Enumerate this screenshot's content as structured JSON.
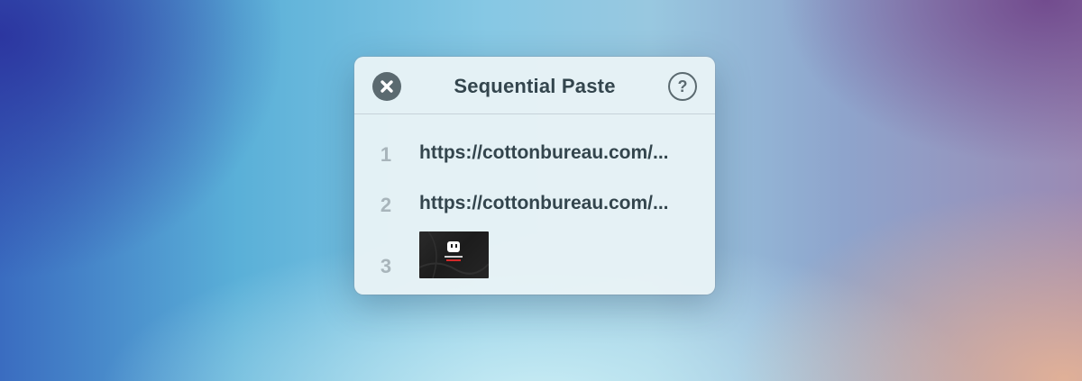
{
  "window": {
    "title": "Sequential Paste",
    "close_icon": "close-icon",
    "help_label": "?"
  },
  "items": [
    {
      "number": "1",
      "type": "text",
      "value": "https://cottonbureau.com/..."
    },
    {
      "number": "2",
      "type": "text",
      "value": "https://cottonbureau.com/..."
    },
    {
      "number": "3",
      "type": "image",
      "value": ""
    }
  ],
  "colors": {
    "text": "#33454d",
    "number": "#a8b5bb",
    "close_button": "#5b6a70",
    "accent_red": "#d42a2a"
  }
}
